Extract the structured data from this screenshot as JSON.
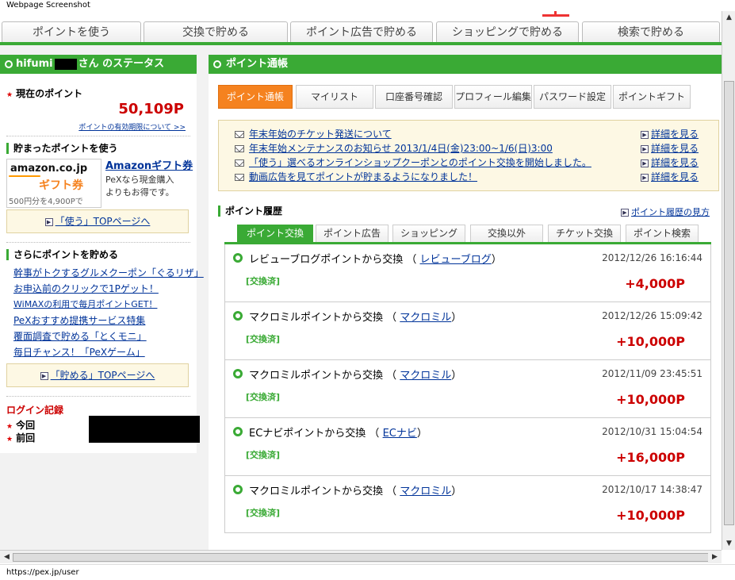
{
  "window": {
    "title": "Webpage Screenshot",
    "status_url": "https://pex.jp/user"
  },
  "topnav": {
    "tabs": [
      "ポイントを使う",
      "交換で貯める",
      "ポイント広告で貯める",
      "ショッピングで貯める",
      "検索で貯める"
    ]
  },
  "status": {
    "user_prefix": "hifumi",
    "user_suffix": "さん のステータス",
    "current_points_label": "現在のポイント",
    "current_points_value": "50,109P",
    "expiry_link": "ポイントの有効期限について >>",
    "use_title": "貯まったポイントを使う",
    "amazon_logo_text": "amazon.co.jp",
    "amazon_logo_sub": "ギフト券",
    "amazon_logo_rate": "500円分を4,900Pで",
    "amazon_link": "Amazonギフト券",
    "amazon_desc_1": "PeXなら現金購入",
    "amazon_desc_2": "よりもお得です。",
    "use_top_button": "「使う」TOPページへ",
    "save_title": "さらにポイントを貯める",
    "save_links": [
      "幹事がトクするグルメクーポン「ぐるリザ」",
      "お申込前のクリックで1Pゲット！",
      "WiMAXの利用で毎月ポイントGET！",
      "PeXおすすめ提携サービス特集",
      "覆面調査で貯める「とくモニ」",
      "毎日チャンス！「PeXゲーム」"
    ],
    "save_top_button": "「貯める」TOPページへ",
    "login_title": "ログイン記録",
    "login_current": "今回",
    "login_previous": "前回"
  },
  "passbook": {
    "title": "ポイント通帳",
    "subtabs": [
      "ポイント通帳",
      "マイリスト",
      "口座番号確認",
      "プロフィール編集",
      "パスワード設定",
      "ポイントギフト"
    ],
    "notices": [
      {
        "text": "年末年始のチケット発送について",
        "more": "詳細を見る"
      },
      {
        "text": "年末年始メンテナンスのお知らせ 2013/1/4日(金)23:00~1/6(日)3:00",
        "more": "詳細を見る"
      },
      {
        "text": "「使う」選べるオンラインショップクーポンとのポイント交換を開始しました。",
        "more": "詳細を見る"
      },
      {
        "text": "動画広告を見てポイントが貯まるようになりました！",
        "more": "詳細を見る"
      }
    ],
    "history_title": "ポイント履歴",
    "history_help": "ポイント履歴の見方",
    "history_tabs": [
      "ポイント交換",
      "ポイント広告",
      "ショッピング",
      "交換以外",
      "チケット交換",
      "ポイント検索"
    ],
    "history": [
      {
        "desc": "レビューブログポイントから交換",
        "source": "レビューブログ",
        "date": "2012/12/26 16:16:44",
        "status": "[交換済]",
        "points": "+4,000P"
      },
      {
        "desc": "マクロミルポイントから交換",
        "source": "マクロミル",
        "date": "2012/12/26 15:09:42",
        "status": "[交換済]",
        "points": "+10,000P"
      },
      {
        "desc": "マクロミルポイントから交換",
        "source": "マクロミル",
        "date": "2012/11/09 23:45:51",
        "status": "[交換済]",
        "points": "+10,000P"
      },
      {
        "desc": "ECナビポイントから交換",
        "source": "ECナビ",
        "date": "2012/10/31 15:04:54",
        "status": "[交換済]",
        "points": "+16,000P"
      },
      {
        "desc": "マクロミルポイントから交換",
        "source": "マクロミル",
        "date": "2012/10/17 14:38:47",
        "status": "[交換済]",
        "points": "+10,000P"
      }
    ]
  },
  "colors": {
    "accent_green": "#3aaa35",
    "accent_orange": "#f5821f",
    "points_red": "#c00"
  }
}
